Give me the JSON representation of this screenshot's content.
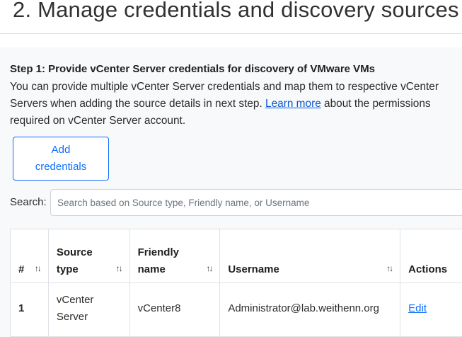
{
  "page": {
    "title": "2. Manage credentials and discovery sources"
  },
  "step1": {
    "heading": "Step 1: Provide vCenter Server credentials for discovery of VMware VMs",
    "description_before_link": "You can provide multiple vCenter Server credentials and map them to respective vCenter Servers when adding the source details in next step. ",
    "learn_more_label": "Learn more",
    "description_after_link": " about the permissions required on vCenter Server account.",
    "add_button_label": "Add credentials"
  },
  "search": {
    "label": "Search:",
    "placeholder": "Search based on Source type, Friendly name, or Username",
    "value": ""
  },
  "table": {
    "columns": [
      {
        "label": "#",
        "sortable": true
      },
      {
        "label": "Source type",
        "sortable": true
      },
      {
        "label": "Friendly name",
        "sortable": true
      },
      {
        "label": "Username",
        "sortable": true
      },
      {
        "label": "Actions",
        "sortable": false
      }
    ],
    "sort_glyph": "↑↓",
    "rows": [
      {
        "num": "1",
        "source_type": "vCenter Server",
        "friendly_name": "vCenter8",
        "username": "Administrator@lab.weithenn.org",
        "action_label": "Edit"
      }
    ]
  },
  "colors": {
    "accent": "#0d6efd",
    "panel_bg": "#f8f9fa",
    "border": "#dee2e6"
  }
}
